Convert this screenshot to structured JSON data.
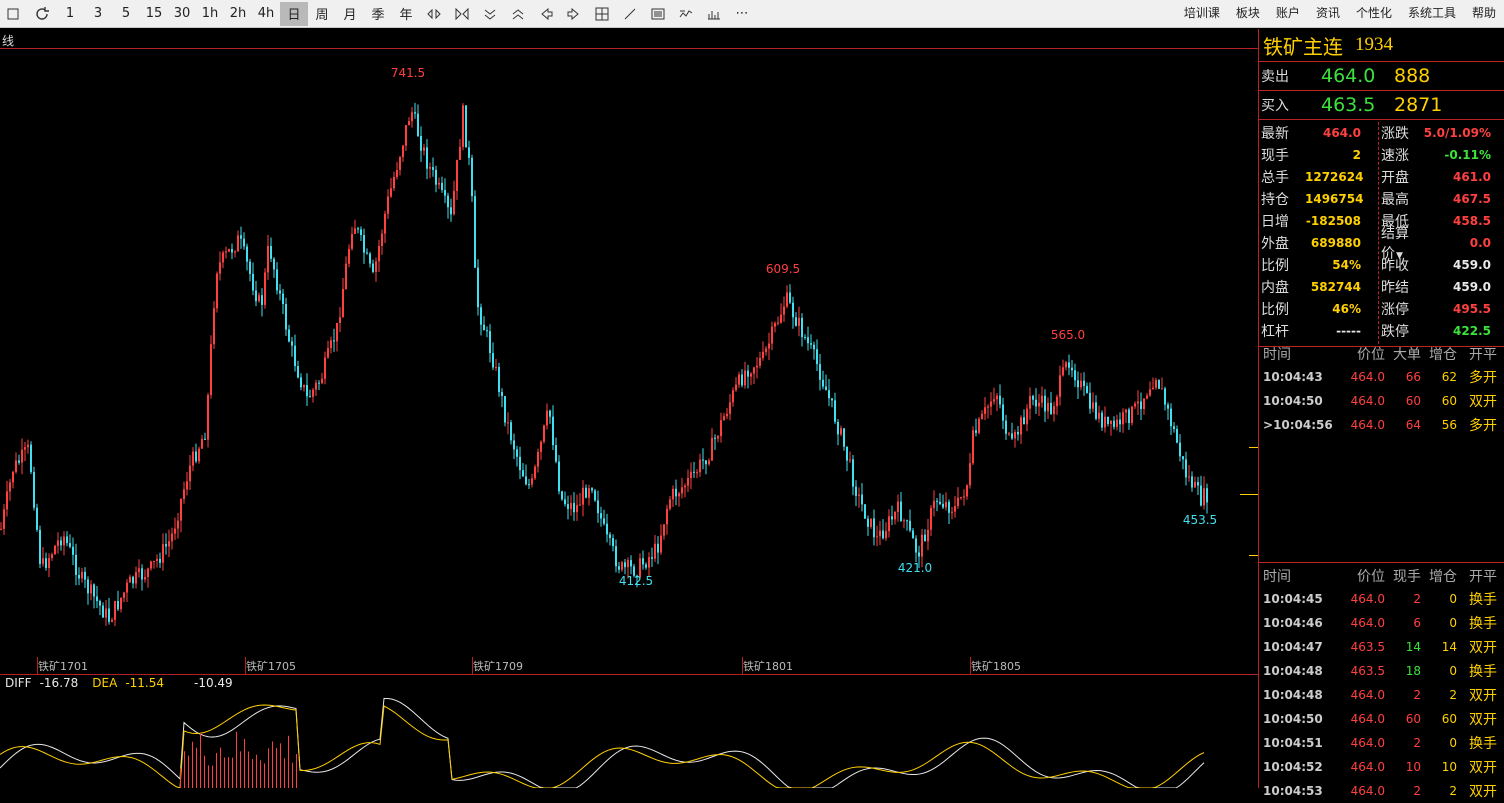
{
  "toolbar": {
    "items": [
      "1",
      "3",
      "5",
      "15",
      "30",
      "1h",
      "2h",
      "4h",
      "日",
      "周",
      "月",
      "季",
      "年"
    ],
    "active": "日",
    "menus": [
      "培训课",
      "板块",
      "账户",
      "资讯",
      "个性化",
      "系统工具",
      "帮助"
    ]
  },
  "chart": {
    "label": "线",
    "annotations": {
      "high1": "741.5",
      "high2": "609.5",
      "high3": "565.0",
      "low1": "412.5",
      "low2": "421.0",
      "last": "453.5"
    },
    "xlabels": [
      "铁矿1701",
      "铁矿1705",
      "铁矿1709",
      "铁矿1801",
      "铁矿1805"
    ]
  },
  "macd": {
    "diff_label": "DIFF",
    "diff_value": "-16.78",
    "dea_label": "DEA",
    "dea_value": "-11.54",
    "macd_value": "-10.49"
  },
  "quote": {
    "name": "铁矿主连",
    "code": "1934",
    "sell_label": "卖出",
    "sell_price": "464.0",
    "sell_vol": "888",
    "buy_label": "买入",
    "buy_price": "463.5",
    "buy_vol": "2871",
    "stats": [
      {
        "l1": "最新",
        "v1": "464.0",
        "c1": "red",
        "l2": "涨跌",
        "v2": "5.0/1.09%",
        "c2": "red"
      },
      {
        "l1": "现手",
        "v1": "2",
        "c1": "yellow",
        "l2": "速涨",
        "v2": "-0.11%",
        "c2": "green"
      },
      {
        "l1": "总手",
        "v1": "1272624",
        "c1": "yellow",
        "l2": "开盘",
        "v2": "461.0",
        "c2": "red"
      },
      {
        "l1": "持仓",
        "v1": "1496754",
        "c1": "yellow",
        "l2": "最高",
        "v2": "467.5",
        "c2": "red"
      },
      {
        "l1": "日增",
        "v1": "-182508",
        "c1": "yellow",
        "l2": "最低",
        "v2": "458.5",
        "c2": "red"
      },
      {
        "l1": "外盘",
        "v1": "689880",
        "c1": "yellow",
        "l2": "结算价",
        "v2": "0.0",
        "c2": "red"
      },
      {
        "l1": "比例",
        "v1": "54%",
        "c1": "yellow",
        "l2": "昨收",
        "v2": "459.0",
        "c2": "white"
      },
      {
        "l1": "内盘",
        "v1": "582744",
        "c1": "yellow",
        "l2": "昨结",
        "v2": "459.0",
        "c2": "white"
      },
      {
        "l1": "比例",
        "v1": "46%",
        "c1": "yellow",
        "l2": "涨停",
        "v2": "495.5",
        "c2": "red"
      },
      {
        "l1": "杠杆",
        "v1": "-----",
        "c1": "white",
        "l2": "跌停",
        "v2": "422.5",
        "c2": "green"
      }
    ]
  },
  "trades": {
    "headers": [
      "时间",
      "价位",
      "大单",
      "增仓",
      "开平"
    ],
    "rows": [
      {
        "time": "10:04:43",
        "price": "464.0",
        "vol": "66",
        "chg": "62",
        "type": "多开",
        "marker": ""
      },
      {
        "time": "10:04:50",
        "price": "464.0",
        "vol": "60",
        "chg": "60",
        "type": "双开",
        "marker": ""
      },
      {
        "time": "10:04:56",
        "price": "464.0",
        "vol": "64",
        "chg": "56",
        "type": "多开",
        "marker": ">"
      }
    ]
  },
  "ticks": {
    "headers": [
      "时间",
      "价位",
      "现手",
      "增仓",
      "开平"
    ],
    "rows": [
      {
        "time": "10:04:45",
        "price": "464.0",
        "pc": "red",
        "vol": "2",
        "vc": "red",
        "chg": "0",
        "type": "换手"
      },
      {
        "time": "10:04:46",
        "price": "464.0",
        "pc": "red",
        "vol": "6",
        "vc": "red",
        "chg": "0",
        "type": "换手"
      },
      {
        "time": "10:04:47",
        "price": "463.5",
        "pc": "red",
        "vol": "14",
        "vc": "green",
        "chg": "14",
        "type": "双开"
      },
      {
        "time": "10:04:48",
        "price": "463.5",
        "pc": "red",
        "vol": "18",
        "vc": "green",
        "chg": "0",
        "type": "换手"
      },
      {
        "time": "10:04:48",
        "price": "464.0",
        "pc": "red",
        "vol": "2",
        "vc": "red",
        "chg": "2",
        "type": "双开"
      },
      {
        "time": "10:04:50",
        "price": "464.0",
        "pc": "red",
        "vol": "60",
        "vc": "red",
        "chg": "60",
        "type": "双开"
      },
      {
        "time": "10:04:51",
        "price": "464.0",
        "pc": "red",
        "vol": "2",
        "vc": "red",
        "chg": "0",
        "type": "换手"
      },
      {
        "time": "10:04:52",
        "price": "464.0",
        "pc": "red",
        "vol": "10",
        "vc": "red",
        "chg": "10",
        "type": "双开"
      },
      {
        "time": "10:04:53",
        "price": "464.0",
        "pc": "red",
        "vol": "2",
        "vc": "red",
        "chg": "2",
        "type": "双开"
      }
    ]
  },
  "colors": {
    "up": "#ff4040",
    "down": "#40e0f0",
    "accent": "#ffd000",
    "grid": "#b22222"
  }
}
